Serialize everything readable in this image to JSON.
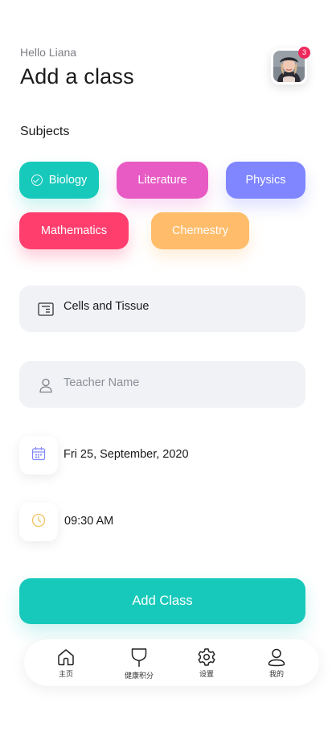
{
  "header": {
    "greeting": "Hello Liana",
    "title": "Add a class",
    "notification_count": "3",
    "avatar_icon": "user-avatar"
  },
  "subjects": {
    "label": "Subjects",
    "items": [
      {
        "label": "Biology",
        "color": "#17c9bb",
        "selected": true
      },
      {
        "label": "Literature",
        "color": "#e85bc4",
        "selected": false
      },
      {
        "label": "Physics",
        "color": "#7f86ff",
        "selected": false
      },
      {
        "label": "Mathematics",
        "color": "#ff3e6e",
        "selected": false
      },
      {
        "label": "Chemestry",
        "color": "#ffbc6a",
        "selected": false
      }
    ]
  },
  "form": {
    "topic": {
      "value": "Cells and Tissue",
      "icon": "document-icon"
    },
    "teacher": {
      "placeholder": "Teacher Name",
      "value": "",
      "icon": "user-icon"
    },
    "date": {
      "value": "Fri 25, September, 2020",
      "icon": "calendar-icon",
      "icon_color": "#7f86ff"
    },
    "time": {
      "value": "09:30 AM",
      "icon": "clock-icon",
      "icon_color": "#f3c160"
    }
  },
  "cta": {
    "label": "Add Class",
    "color": "#17c9bb"
  },
  "tabbar": {
    "items": [
      {
        "label": "主页",
        "icon": "home-icon"
      },
      {
        "label": "健康积分",
        "icon": "cup-icon"
      },
      {
        "label": "设置",
        "icon": "gear-icon"
      },
      {
        "label": "我的",
        "icon": "person-icon"
      }
    ]
  }
}
